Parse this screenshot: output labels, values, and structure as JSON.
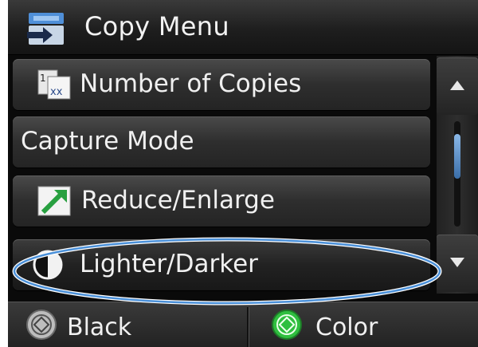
{
  "header": {
    "title": "Copy Menu",
    "icon": "copy-icon"
  },
  "menu": {
    "items": [
      {
        "label": "Number of Copies",
        "icon": "copies-count-icon"
      },
      {
        "label": "Capture Mode",
        "icon": ""
      },
      {
        "label": "Reduce/Enlarge",
        "icon": "reduce-enlarge-icon"
      },
      {
        "label": "Lighter/Darker",
        "icon": "contrast-icon",
        "selected": true
      }
    ]
  },
  "scrollbar": {
    "up_icon": "arrow-up-icon",
    "down_icon": "arrow-down-icon"
  },
  "bottom": {
    "black_label": "Black",
    "color_label": "Color"
  },
  "colors": {
    "start_green": "#2fbf3f",
    "accent_blue": "#4a90d9"
  }
}
